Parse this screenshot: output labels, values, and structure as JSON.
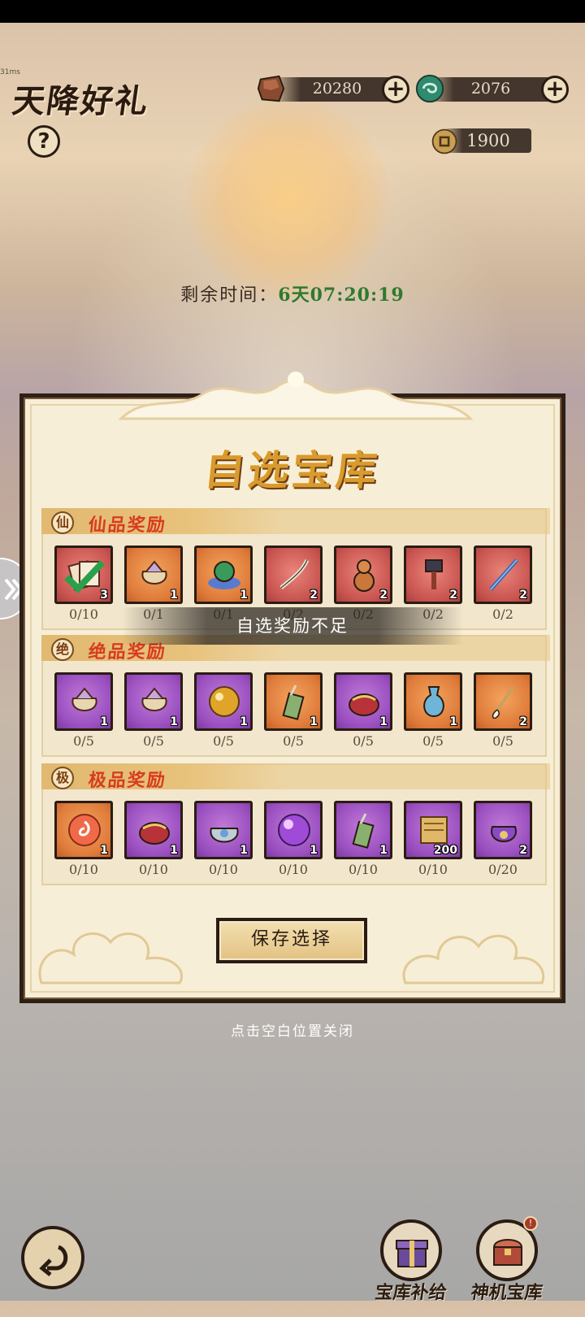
{
  "header": {
    "fps": "31ms",
    "title": "天降好礼",
    "help_label": "?",
    "currencies": [
      {
        "name": "ore-icon",
        "value": "20280"
      },
      {
        "name": "jade-icon",
        "value": "2076"
      },
      {
        "name": "coin-icon",
        "value": "1900"
      }
    ],
    "plus_label": "+"
  },
  "timer": {
    "label": "剩余时间：",
    "value": "6天07:20:19"
  },
  "panel": {
    "title": "自选宝库",
    "sections": [
      {
        "badge": "仙",
        "label": "仙品奖励",
        "items": [
          {
            "icon": "rune-cards-icon",
            "color": "red",
            "qty": "3",
            "count": "0/10",
            "checked": true
          },
          {
            "icon": "pouch-icon",
            "color": "orange",
            "qty": "1",
            "count": "0/1"
          },
          {
            "icon": "dragon-treasure-icon",
            "color": "orange",
            "qty": "1",
            "count": "0/1"
          },
          {
            "icon": "saber-icon",
            "color": "red",
            "qty": "2",
            "count": "0/2"
          },
          {
            "icon": "gourd-icon",
            "color": "red",
            "qty": "2",
            "count": "0/2"
          },
          {
            "icon": "hammer-icon",
            "color": "red",
            "qty": "2",
            "count": "0/2"
          },
          {
            "icon": "spear-icon",
            "color": "red",
            "qty": "2",
            "count": "0/2"
          }
        ]
      },
      {
        "badge": "绝",
        "label": "绝品奖励",
        "items": [
          {
            "icon": "pouch-icon",
            "color": "purple",
            "qty": "1",
            "count": "0/5"
          },
          {
            "icon": "pouch-icon",
            "color": "purple",
            "qty": "1",
            "count": "0/5"
          },
          {
            "icon": "golden-orb-icon",
            "color": "purple",
            "qty": "1",
            "count": "0/5"
          },
          {
            "icon": "quiver-icon",
            "color": "orange",
            "qty": "1",
            "count": "0/5"
          },
          {
            "icon": "red-pouch-icon",
            "color": "purple",
            "qty": "1",
            "count": "0/5"
          },
          {
            "icon": "vase-icon",
            "color": "orange",
            "qty": "1",
            "count": "0/5"
          },
          {
            "icon": "brush-icon",
            "color": "orange",
            "qty": "2",
            "count": "0/5"
          }
        ]
      },
      {
        "badge": "极",
        "label": "极品奖励",
        "items": [
          {
            "icon": "fire-orb-icon",
            "color": "orange",
            "qty": "1",
            "count": "0/10"
          },
          {
            "icon": "red-pouch-icon",
            "color": "purple",
            "qty": "1",
            "count": "0/10"
          },
          {
            "icon": "silver-pouch-icon",
            "color": "purple",
            "qty": "1",
            "count": "0/10"
          },
          {
            "icon": "purple-orb-icon",
            "color": "purple",
            "qty": "1",
            "count": "0/10"
          },
          {
            "icon": "quiver-icon",
            "color": "purple",
            "qty": "1",
            "count": "0/10"
          },
          {
            "icon": "scroll-icon",
            "color": "purple",
            "qty": "200",
            "count": "0/10"
          },
          {
            "icon": "purple-sack-icon",
            "color": "purple",
            "qty": "2",
            "count": "0/20"
          }
        ]
      }
    ],
    "toast": "自选奖励不足",
    "save_label": "保存选择"
  },
  "close_hint": "点击空白位置关闭",
  "bottom": {
    "left_label": "宝库补给",
    "right_label": "神机宝库",
    "right_badge": "!"
  },
  "colors": {
    "timer_value": "#2f7a2e",
    "section_label": "#d83b1f",
    "title": "#d99a2e"
  }
}
